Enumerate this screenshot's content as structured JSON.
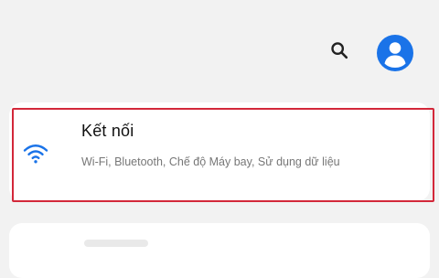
{
  "header": {
    "search_icon": "search-icon",
    "account_icon": "account-icon",
    "accent_color": "#1a73e8"
  },
  "settings": {
    "connections": {
      "icon": "wifi-icon",
      "title": "Kết nối",
      "subtitle": "Wi-Fi, Bluetooth, Chế độ Máy bay, Sử dụng dữ liệu",
      "highlight_color": "#d3283a"
    }
  }
}
